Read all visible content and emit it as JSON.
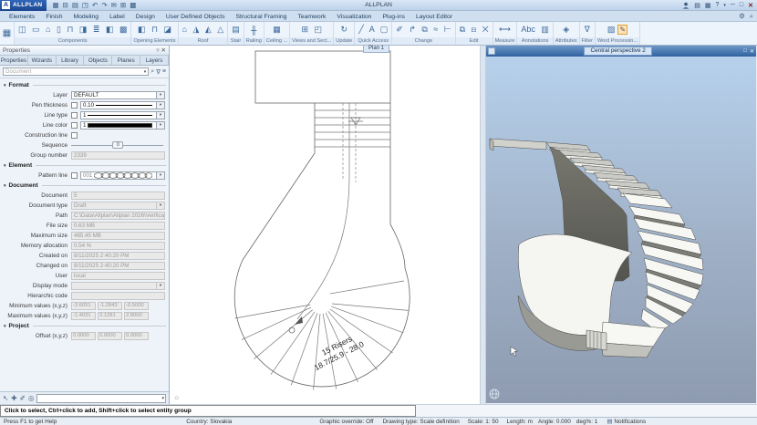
{
  "titlebar": {
    "badge": "A",
    "app_name": "ALLPLAN",
    "window_title": "ALLPLAN",
    "qat_icons": [
      "▦",
      "⊟",
      "▤",
      "◳",
      "↶",
      "↷",
      "✉",
      "⊞",
      "▩"
    ],
    "controls": {
      "grid": "▤",
      "shop": "▦",
      "help": "?",
      "caret": "▾",
      "minimize": "─",
      "restore": "□",
      "close": "✕"
    },
    "gear": "⚙",
    "search": "⌕"
  },
  "tabsrow": {
    "tabs": [
      "Elements",
      "Finish",
      "Modeling",
      "Label",
      "Design",
      "User Defined Objects",
      "Structural Framing",
      "Teamwork",
      "Visualization",
      "Plug-ins",
      "Layout Editor"
    ]
  },
  "ribbon": {
    "launcher_icon": "▦",
    "groups": [
      {
        "icons": "◫ ▭ ⌂ ▯ ⊓ ◨ ≣ ◧ ▩",
        "label": "Components"
      },
      {
        "icons": "◧ ⊓ ◪",
        "label": "Opening Elements"
      },
      {
        "icons": "⌂ ◮ ◭ △",
        "label": "Roof"
      },
      {
        "icons": "▤",
        "label": "Stair"
      },
      {
        "icons": "╫",
        "label": "Railing"
      },
      {
        "icons": "▦",
        "label": "Ceiling ..."
      },
      {
        "icons": "⊞ ◰",
        "label": "Views and Sect..."
      },
      {
        "icons": "↻",
        "label": "Update"
      },
      {
        "icons": "╱ A ▢",
        "label": "Quick Access"
      },
      {
        "icons": "✐ ↱ ⧉ ≈ ⊢",
        "label": "Change"
      },
      {
        "icons": "⧉ ⊟ ✕",
        "label": "Edit"
      },
      {
        "icons": "⟷",
        "label": "Measure"
      },
      {
        "icons": "Abc ▥",
        "label": "Annotations"
      },
      {
        "icons": "◈",
        "label": "Attributes"
      },
      {
        "icons": "∇",
        "label": "Filter"
      },
      {
        "icons": "▨",
        "hl": "✎",
        "label": "Word Processin..."
      }
    ]
  },
  "panel": {
    "title": "Properties",
    "pin_icon": "▿",
    "close_icon": "✕",
    "tabs": [
      "Properties",
      "Wizards",
      "Library",
      "Objects",
      "Planes",
      "Layers"
    ],
    "filter_placeholder": "Document",
    "filter_icons": {
      "search": "⌕",
      "funnel": "∇",
      "list": "≡"
    },
    "format": {
      "header": "Format",
      "layer_label": "Layer",
      "layer_value": "DEFAULT",
      "pen_label": "Pen thickness",
      "pen_value": "0.10",
      "linetype_label": "Line type",
      "linetype_value": "1",
      "linecolor_label": "Line color",
      "linecolor_value": "1",
      "construction_label": "Construction line",
      "sequence_label": "Sequence",
      "sequence_value": "0",
      "groupnum_label": "Group number",
      "groupnum_value": "2339"
    },
    "element": {
      "header": "Element",
      "pattern_label": "Pattern line",
      "pattern_value": "001"
    },
    "document": {
      "header": "Document",
      "rows": [
        {
          "label": "Document",
          "value": "5"
        },
        {
          "label": "Document type",
          "value": "Draft",
          "dd": "▾"
        },
        {
          "label": "Path",
          "value": "C:\\Data\\Allplan\\Allplan 2026\\Verification"
        },
        {
          "label": "File size",
          "value": "0.63 MB"
        },
        {
          "label": "Maximum size",
          "value": "465.45 MB"
        },
        {
          "label": "Memory allocation",
          "value": "0.54 %"
        },
        {
          "label": "Created on",
          "value": "8/11/2025 2:40:20 PM"
        },
        {
          "label": "Changed on",
          "value": "8/11/2025 2:40:20 PM"
        },
        {
          "label": "User",
          "value": "local"
        },
        {
          "label": "Display mode",
          "value": "",
          "dd": "▾"
        },
        {
          "label": "Hierarchic code",
          "value": ""
        }
      ],
      "min_label": "Minimum values (x,y,z)",
      "min": [
        "-3.6051",
        "-1.2843",
        "-0.5000"
      ],
      "max_label": "Maximum values (x,y,z)",
      "max": [
        "-1.4031",
        "3.1281",
        "2.8000"
      ]
    },
    "project": {
      "header": "Project",
      "offset_label": "Offset (x,y,z)",
      "offset": [
        "0.0000",
        "0.0000",
        "0.0000"
      ]
    },
    "action_icons": [
      "↖",
      "✚",
      "✐",
      "◎"
    ]
  },
  "plan": {
    "tab": "Plan 1",
    "annotation_line1": "15 Risers",
    "annotation_line2": "18.7/25.9 - 28.0",
    "sun_icon": "☼"
  },
  "persp": {
    "title": "Central perspective 2",
    "restore_icon": "□",
    "close_icon": "✕"
  },
  "hint": "Click to select, Ctrl+click to add, Shift+click to select entity group",
  "statusbar": {
    "help": "Press F1 to get Help",
    "items": [
      "Country:  Slovakia",
      "Graphic override:  Off",
      "Drawing type:  Scale definition",
      "Scale:  1: 50",
      "Length:  m",
      "Angle:  0.000",
      "deg",
      "%:  1"
    ],
    "notif_icon": "▤",
    "notif": "Notifications"
  },
  "ui": {
    "chev": "▾"
  }
}
